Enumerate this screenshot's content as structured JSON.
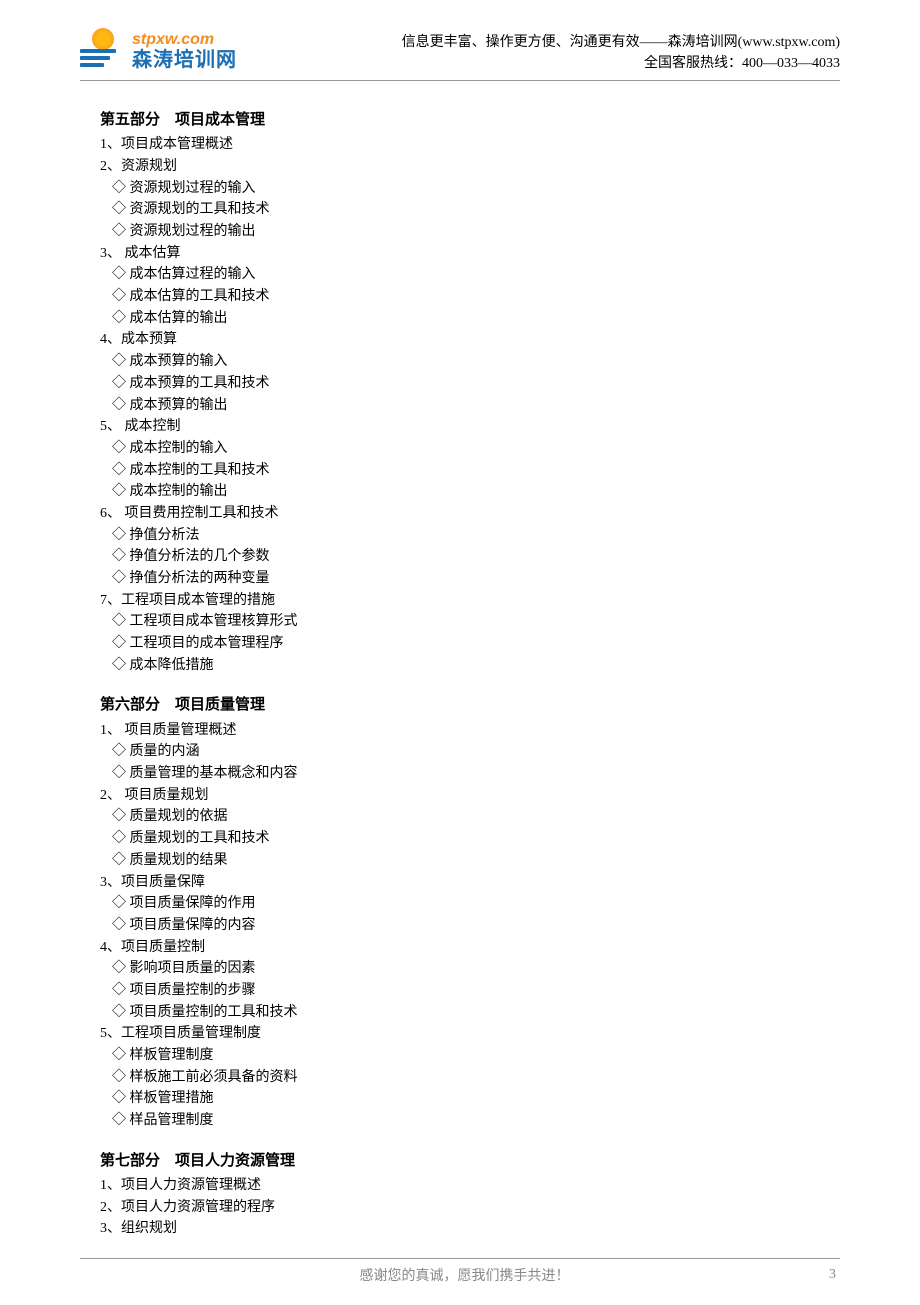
{
  "header": {
    "logo_url": "stpxw.com",
    "logo_cn": "森涛培训网",
    "tagline": "信息更丰富、操作更方便、沟通更有效——森涛培训网(www.stpxw.com)",
    "hotline": "全国客服热线：400—033—4033"
  },
  "sections": [
    {
      "title": "第五部分　项目成本管理",
      "lines": [
        {
          "cls": "item-num",
          "text": "1、项目成本管理概述"
        },
        {
          "cls": "item-num",
          "text": "2、资源规划"
        },
        {
          "cls": "item-sub",
          "text": "◇ 资源规划过程的输入"
        },
        {
          "cls": "item-sub",
          "text": "◇ 资源规划的工具和技术"
        },
        {
          "cls": "item-sub",
          "text": "◇ 资源规划过程的输出"
        },
        {
          "cls": "item-num",
          "text": "3、 成本估算"
        },
        {
          "cls": "item-sub",
          "text": "◇ 成本估算过程的输入"
        },
        {
          "cls": "item-sub",
          "text": "◇ 成本估算的工具和技术"
        },
        {
          "cls": "item-sub",
          "text": "◇ 成本估算的输出"
        },
        {
          "cls": "item-num",
          "text": "4、成本预算"
        },
        {
          "cls": "item-sub",
          "text": "◇ 成本预算的输入"
        },
        {
          "cls": "item-sub",
          "text": "◇ 成本预算的工具和技术"
        },
        {
          "cls": "item-sub",
          "text": "◇ 成本预算的输出"
        },
        {
          "cls": "item-num",
          "text": "5、 成本控制"
        },
        {
          "cls": "item-sub",
          "text": "◇ 成本控制的输入"
        },
        {
          "cls": "item-sub",
          "text": "◇ 成本控制的工具和技术"
        },
        {
          "cls": "item-sub",
          "text": "◇ 成本控制的输出"
        },
        {
          "cls": "item-num",
          "text": "6、 项目费用控制工具和技术"
        },
        {
          "cls": "item-sub",
          "text": "◇ 挣值分析法"
        },
        {
          "cls": "item-sub",
          "text": "◇ 挣值分析法的几个参数"
        },
        {
          "cls": "item-sub",
          "text": "◇ 挣值分析法的两种变量"
        },
        {
          "cls": "item-num",
          "text": "7、工程项目成本管理的措施"
        },
        {
          "cls": "item-sub",
          "text": "◇ 工程项目成本管理核算形式"
        },
        {
          "cls": "item-sub",
          "text": "◇ 工程项目的成本管理程序"
        },
        {
          "cls": "item-sub",
          "text": "◇ 成本降低措施"
        }
      ]
    },
    {
      "title": "第六部分　项目质量管理",
      "lines": [
        {
          "cls": "item-num",
          "text": "1、 项目质量管理概述"
        },
        {
          "cls": "item-sub",
          "text": "◇ 质量的内涵"
        },
        {
          "cls": "item-sub",
          "text": "◇ 质量管理的基本概念和内容"
        },
        {
          "cls": "item-num",
          "text": "2、 项目质量规划"
        },
        {
          "cls": "item-sub",
          "text": "◇ 质量规划的依据"
        },
        {
          "cls": "item-sub",
          "text": "◇ 质量规划的工具和技术"
        },
        {
          "cls": "item-sub",
          "text": "◇ 质量规划的结果"
        },
        {
          "cls": "item-num",
          "text": "3、项目质量保障"
        },
        {
          "cls": "item-sub",
          "text": "◇ 项目质量保障的作用"
        },
        {
          "cls": "item-sub",
          "text": "◇ 项目质量保障的内容"
        },
        {
          "cls": "item-num",
          "text": "4、项目质量控制"
        },
        {
          "cls": "item-sub",
          "text": "◇ 影响项目质量的因素"
        },
        {
          "cls": "item-sub",
          "text": "◇ 项目质量控制的步骤"
        },
        {
          "cls": "item-sub",
          "text": "◇ 项目质量控制的工具和技术"
        },
        {
          "cls": "item-num",
          "text": "5、工程项目质量管理制度"
        },
        {
          "cls": "item-sub",
          "text": "◇ 样板管理制度"
        },
        {
          "cls": "item-sub",
          "text": "◇ 样板施工前必须具备的资料"
        },
        {
          "cls": "item-sub",
          "text": "◇ 样板管理措施"
        },
        {
          "cls": "item-sub",
          "text": "◇ 样品管理制度"
        }
      ]
    },
    {
      "title": "第七部分　项目人力资源管理",
      "lines": [
        {
          "cls": "item-num",
          "text": "1、项目人力资源管理概述"
        },
        {
          "cls": "item-num",
          "text": "2、项目人力资源管理的程序"
        },
        {
          "cls": "item-num",
          "text": "3、组织规划"
        }
      ]
    }
  ],
  "footer": {
    "center": "感谢您的真诚，愿我们携手共进！",
    "page": "3"
  }
}
